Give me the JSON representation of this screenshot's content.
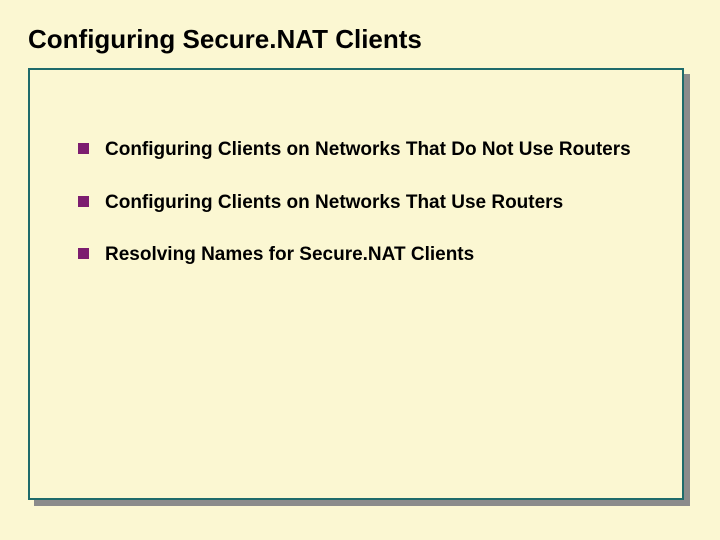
{
  "title": "Configuring Secure.NAT Clients",
  "bullets": [
    {
      "text": "Configuring Clients on Networks That Do Not Use Routers"
    },
    {
      "text": "Configuring Clients on Networks That Use Routers"
    },
    {
      "text": "Resolving Names for Secure.NAT Clients"
    }
  ]
}
